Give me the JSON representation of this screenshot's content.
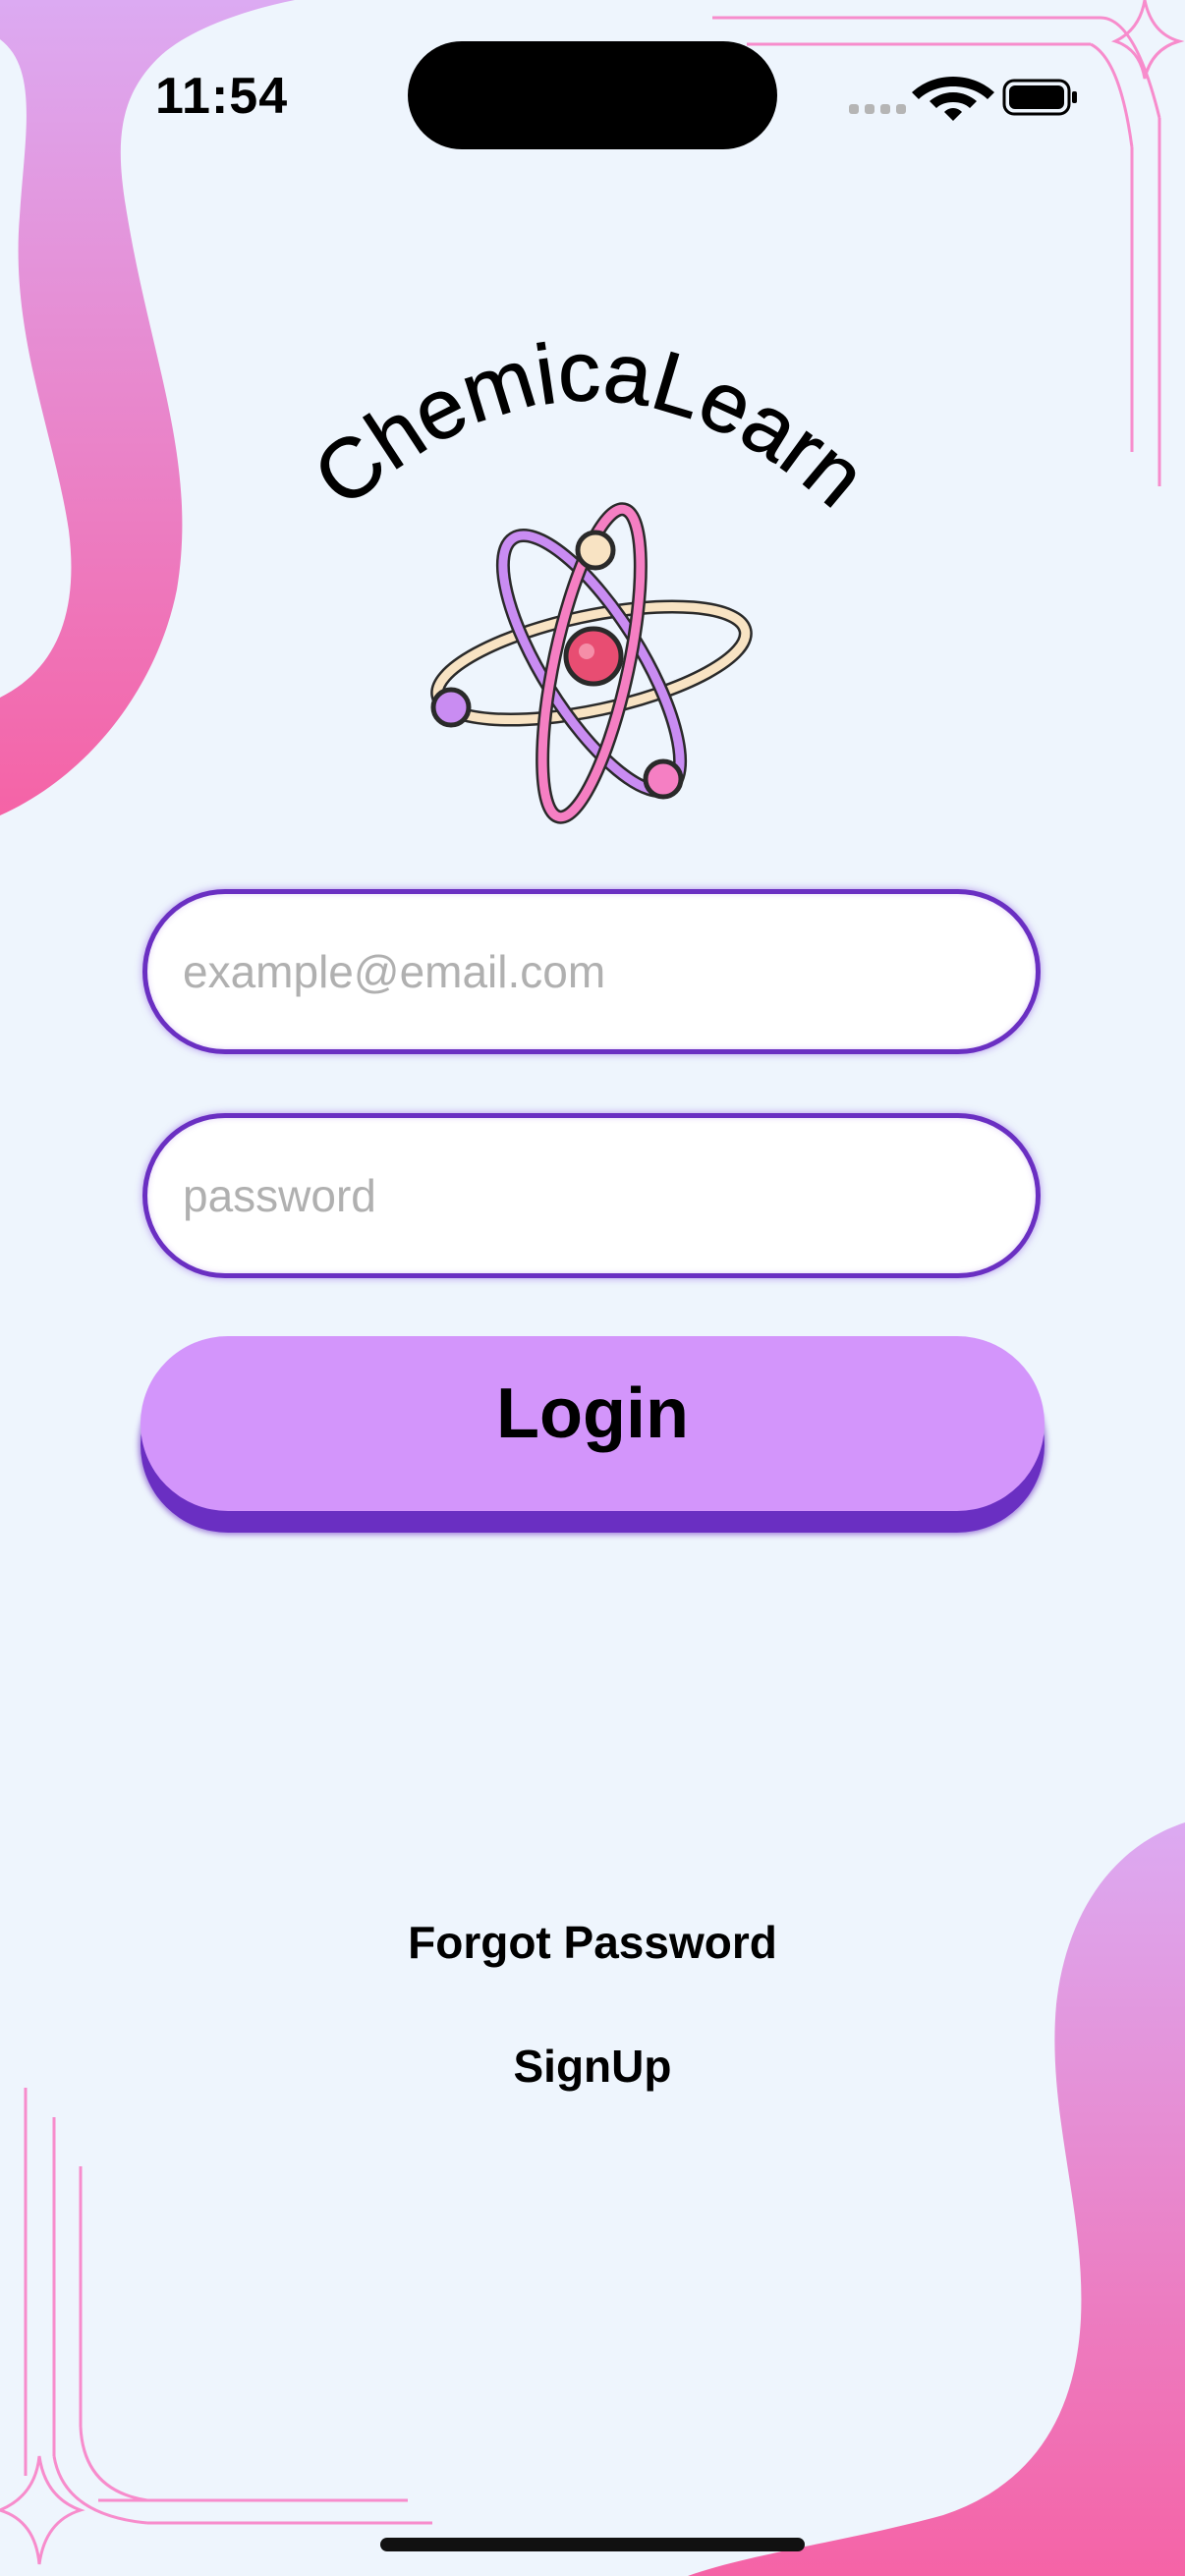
{
  "status_bar": {
    "time": "11:54",
    "icons": [
      "signal-icon",
      "wifi-icon",
      "battery-icon"
    ]
  },
  "logo": {
    "text": "ChemicaLearn",
    "icon": "atom-icon"
  },
  "form": {
    "email_placeholder": "example@email.com",
    "email_value": "",
    "password_placeholder": "password",
    "password_value": "",
    "login_label": "Login"
  },
  "links": {
    "forgot_password": "Forgot Password",
    "signup": "SignUp"
  },
  "colors": {
    "background": "#eef5fd",
    "accent_purple": "#6a2fc2",
    "button_fill": "#d395fb",
    "decor_pink": "#f25ca8",
    "decor_lilac": "#dca6ee"
  }
}
